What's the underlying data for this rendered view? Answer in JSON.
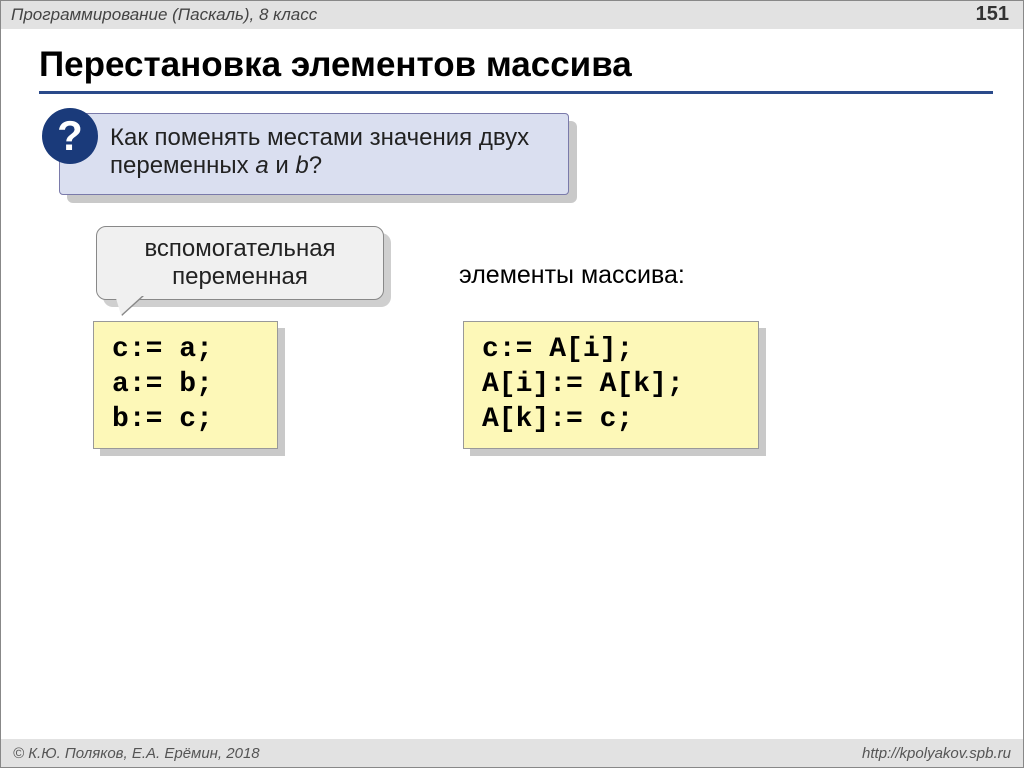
{
  "header": {
    "title": "Программирование (Паскаль), 8 класс",
    "page_number": "151"
  },
  "heading": "Перестановка элементов массива",
  "question": {
    "badge": "?",
    "text_part1": "Как поменять местами значения двух переменных ",
    "var_a": "a",
    "text_and": " и ",
    "var_b": "b",
    "text_q": "?"
  },
  "helper_label": "вспомогательная\nпеременная",
  "array_label": "элементы массива:",
  "code_left": "c:= a;\na:= b;\nb:= c;",
  "code_right": "c:= A[i];\nA[i]:= A[k];\nA[k]:= c;",
  "footer": {
    "copyright": "© К.Ю. Поляков, Е.А. Ерёмин, 2018",
    "url": "http://kpolyakov.spb.ru"
  }
}
